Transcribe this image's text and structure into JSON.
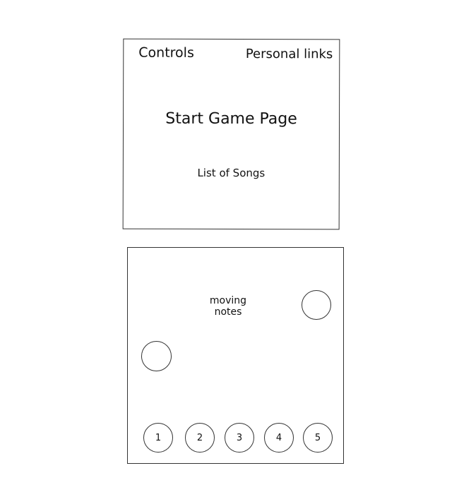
{
  "start_page": {
    "controls_label": "Controls",
    "personal_links_label": "Personal links",
    "title": "Start Game Page",
    "songs_label": "List of Songs"
  },
  "game_page": {
    "moving_notes_line1": "moving",
    "moving_notes_line2": "notes",
    "keys": [
      "1",
      "2",
      "3",
      "4",
      "5"
    ]
  },
  "colors": {
    "stroke": "#333333",
    "text": "#111111",
    "background": "#ffffff"
  }
}
